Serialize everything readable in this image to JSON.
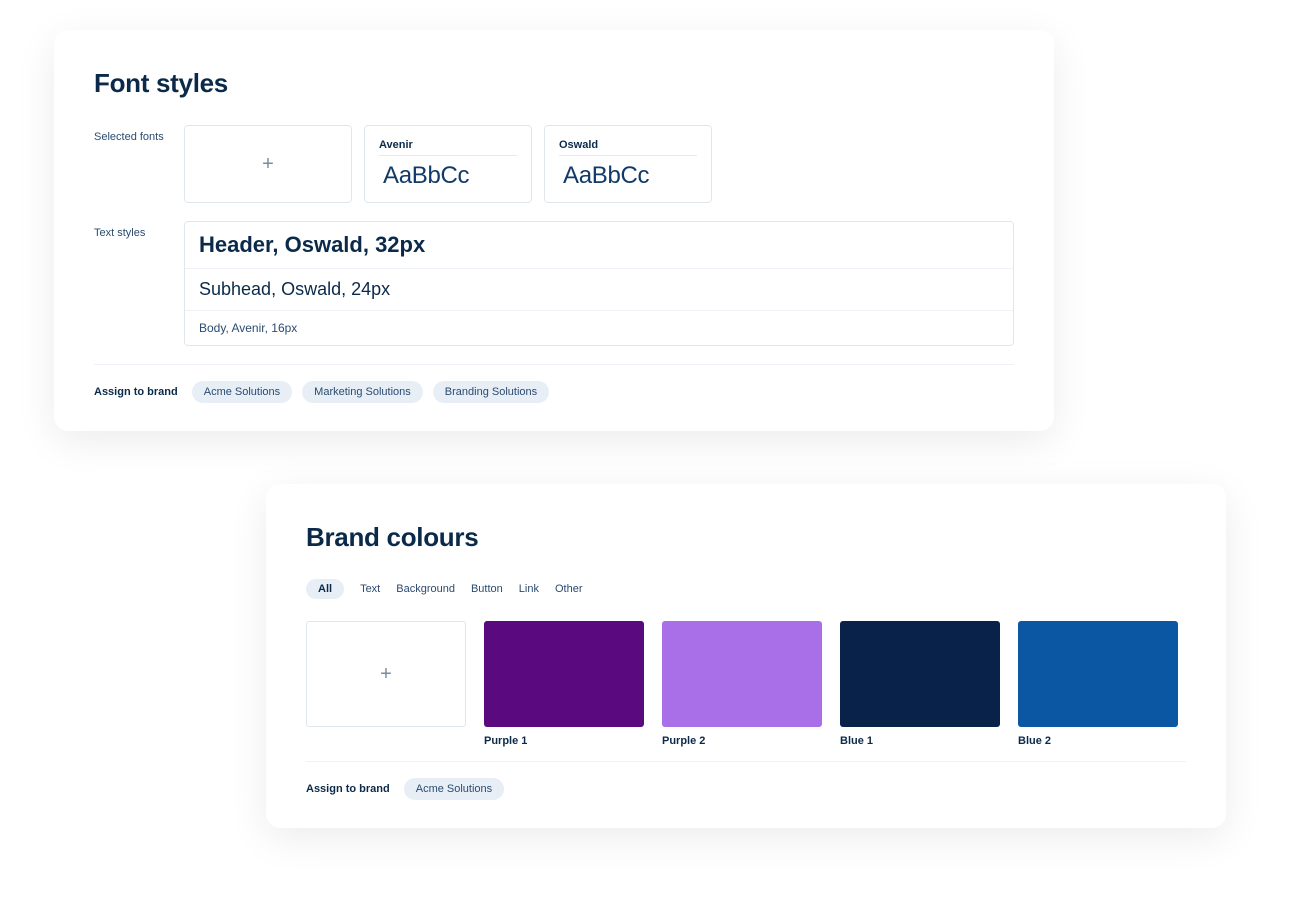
{
  "fonts_panel": {
    "title": "Font styles",
    "selected_label": "Selected fonts",
    "text_styles_label": "Text styles",
    "sample": "AaBbCc",
    "fonts": [
      {
        "name": "Avenir"
      },
      {
        "name": "Oswald"
      }
    ],
    "text_styles": [
      {
        "label": "Header, Oswald, 32px",
        "class": "ts-header"
      },
      {
        "label": "Subhead, Oswald, 24px",
        "class": "ts-sub"
      },
      {
        "label": "Body, Avenir, 16px",
        "class": "ts-body"
      }
    ],
    "assign_label": "Assign to brand",
    "assign_chips": [
      "Acme Solutions",
      "Marketing Solutions",
      "Branding Solutions"
    ]
  },
  "colours_panel": {
    "title": "Brand colours",
    "filters": [
      "All",
      "Text",
      "Background",
      "Button",
      "Link",
      "Other"
    ],
    "active_filter": "All",
    "swatches": [
      {
        "name": "Purple 1",
        "hex": "#5a097e"
      },
      {
        "name": "Purple 2",
        "hex": "#a86fe8"
      },
      {
        "name": "Blue 1",
        "hex": "#082249"
      },
      {
        "name": "Blue 2",
        "hex": "#0b57a4"
      }
    ],
    "assign_label": "Assign to brand",
    "assign_chips": [
      "Acme Solutions"
    ]
  }
}
